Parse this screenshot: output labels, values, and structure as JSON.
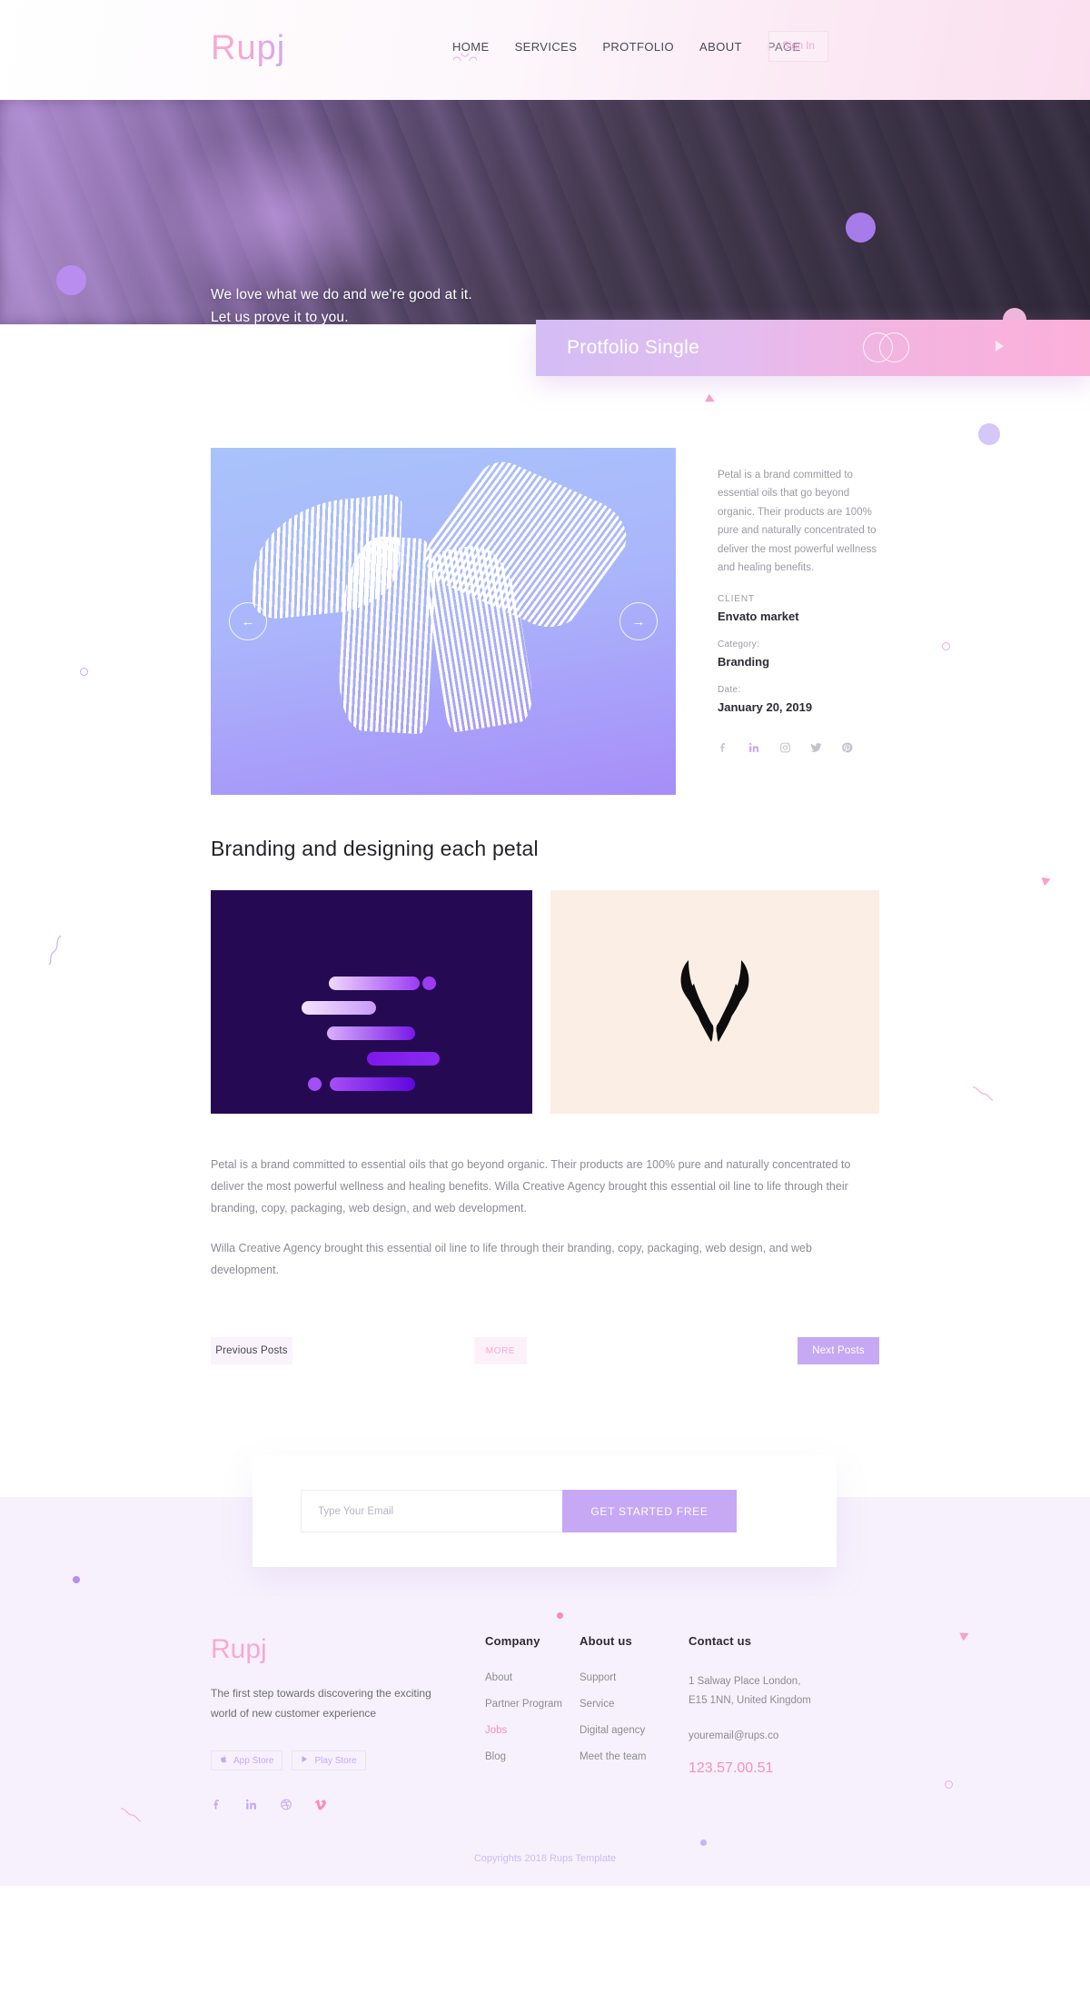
{
  "header": {
    "logo": "Rupj",
    "nav": [
      {
        "label": "HOME",
        "active": true
      },
      {
        "label": "SERVICES",
        "active": false
      },
      {
        "label": "PROTFOLIO",
        "active": false
      },
      {
        "label": "ABOUT",
        "active": false
      },
      {
        "label": "PAGE",
        "active": false
      }
    ],
    "signin_label": "Sign In"
  },
  "hero": {
    "line1": "We love what we do and we're good at it.",
    "line2": "Let us prove it to you."
  },
  "banner": {
    "title": "Protfolio Single"
  },
  "detail": {
    "description": "Petal is a brand committed to essential oils that go beyond organic. Their products are 100% pure and naturally concentrated to deliver the most powerful wellness and healing benefits.",
    "client_label": "CLIENT",
    "client_value": "Envato market",
    "category_label": "Category:",
    "category_value": "Branding",
    "date_label": "Date:",
    "date_value": "January 20, 2019",
    "prev_arrow": "←",
    "next_arrow": "→",
    "socials": [
      {
        "name": "facebook",
        "highlight": false
      },
      {
        "name": "linkedin",
        "highlight": true
      },
      {
        "name": "instagram",
        "highlight": false
      },
      {
        "name": "twitter",
        "highlight": false
      },
      {
        "name": "pinterest",
        "highlight": false
      }
    ]
  },
  "article": {
    "title": "Branding and designing each petal",
    "paragraph1": "Petal is a brand committed to essential oils that go beyond organic. Their products are 100% pure and naturally concentrated to deliver the most powerful wellness and healing benefits. Willa Creative Agency brought this essential oil line to life through their branding, copy, packaging, web design, and web development.",
    "paragraph2": "Willa Creative Agency brought this essential oil line to life through their branding, copy, packaging, web design, and web development."
  },
  "pager": {
    "previous": "Previous Posts",
    "more": "MORE",
    "next": "Next Posts"
  },
  "newsletter": {
    "placeholder": "Type Your Email",
    "value": "",
    "button": "GET STARTED FREE"
  },
  "footer": {
    "logo": "Rupj",
    "tagline": "The first step towards discovering the exciting world of new customer experience",
    "stores": [
      {
        "label": "App Store",
        "icon": "apple-icon"
      },
      {
        "label": "Play Store",
        "icon": "play-icon"
      }
    ],
    "socials": [
      {
        "name": "facebook",
        "pink": false
      },
      {
        "name": "linkedin",
        "pink": false
      },
      {
        "name": "dribbble",
        "pink": false
      },
      {
        "name": "vimeo",
        "pink": true
      }
    ],
    "columns": [
      {
        "heading": "Company",
        "links": [
          {
            "label": "About",
            "highlight": false
          },
          {
            "label": "Partner Program",
            "highlight": false
          },
          {
            "label": "Jobs",
            "highlight": true
          },
          {
            "label": "Blog",
            "highlight": false
          }
        ]
      },
      {
        "heading": "About us",
        "links": [
          {
            "label": "Support",
            "highlight": false
          },
          {
            "label": "Service",
            "highlight": false
          },
          {
            "label": "Digital agency",
            "highlight": false
          },
          {
            "label": "Meet the team",
            "highlight": false
          }
        ]
      }
    ],
    "contact": {
      "heading": "Contact us",
      "address_line1": "1 Salway Place London,",
      "address_line2": "E15 1NN, United Kingdom",
      "email": "youremail@rups.co",
      "phone": "123.57.00.51"
    },
    "copyright": "Copyrights 2018 Rups Template"
  },
  "colors": {
    "accent_purple": "#c6a8f5",
    "accent_pink": "#f78fc2",
    "card_dark": "#250a53",
    "card_cream": "#fbeee4",
    "footer_bg": "#f7f1fd"
  }
}
